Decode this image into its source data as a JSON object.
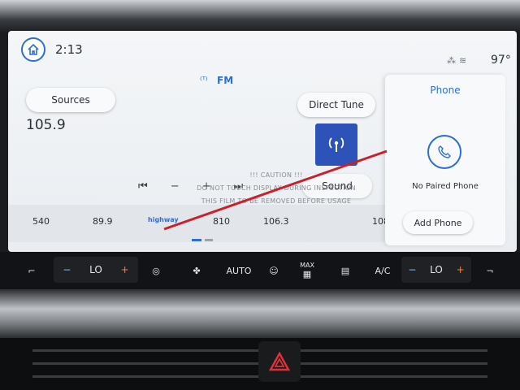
{
  "status": {
    "time": "2:13",
    "temperature": "97°"
  },
  "radio": {
    "band": "FM",
    "sources_label": "Sources",
    "direct_tune_label": "Direct Tune",
    "frequency": "105.9",
    "sound_label": "Sound"
  },
  "caution": {
    "line1": "!!! CAUTION !!!",
    "line2": "DO NOT TOUCH DISPLAY DURING INSPECTION",
    "line3": "THIS FILM TO BE REMOVED BEFORE USAGE"
  },
  "presets": [
    "540",
    "89.9",
    "810",
    "106.3",
    "108"
  ],
  "preset_logo": "highway",
  "phone": {
    "title": "Phone",
    "status": "No Paired Phone",
    "add_label": "Add Phone"
  },
  "climate": {
    "left_temp": "LO",
    "right_temp": "LO",
    "auto_label": "AUTO",
    "max_label": "MAX",
    "ac_label": "A/C"
  },
  "colors": {
    "accent": "#2c6fd1",
    "tile": "#2d53b8",
    "warm": "#ff7a3d"
  }
}
